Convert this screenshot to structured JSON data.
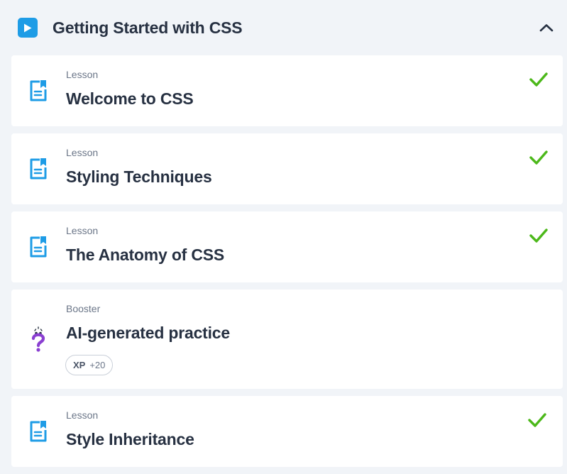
{
  "section": {
    "title": "Getting Started with CSS",
    "icon": "play-icon",
    "toggle_icon": "chevron-up-icon"
  },
  "items": [
    {
      "kind": "Lesson",
      "title": "Welcome to CSS",
      "completed": true,
      "icon": "lesson-document-icon"
    },
    {
      "kind": "Lesson",
      "title": "Styling Techniques",
      "completed": true,
      "icon": "lesson-document-icon"
    },
    {
      "kind": "Lesson",
      "title": "The Anatomy of CSS",
      "completed": true,
      "icon": "lesson-document-icon"
    },
    {
      "kind": "Booster",
      "title": "AI-generated practice",
      "completed": false,
      "icon": "question-mark-icon",
      "xp": {
        "label": "XP",
        "value": "+20"
      }
    },
    {
      "kind": "Lesson",
      "title": "Style Inheritance",
      "completed": true,
      "icon": "lesson-document-icon"
    }
  ],
  "colors": {
    "accent_blue": "#1e9ce6",
    "check_green": "#4cb81a",
    "booster_purple": "#8a3fd1",
    "background": "#f1f4f8"
  }
}
